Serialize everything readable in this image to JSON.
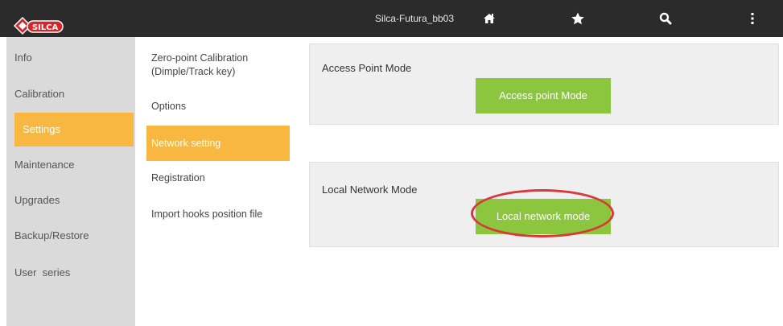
{
  "header": {
    "device_name": "Silca-Futura_bb03",
    "logo_text": "SILCA",
    "icons": [
      "home-icon",
      "star-icon",
      "search-icon",
      "more-vertical-icon"
    ]
  },
  "sidebar": {
    "items": [
      {
        "label": "Info"
      },
      {
        "label": "Calibration"
      },
      {
        "label": "Settings",
        "active": true
      },
      {
        "label": "Maintenance"
      },
      {
        "label": "Upgrades"
      },
      {
        "label": "Backup/Restore"
      },
      {
        "label": "User  series"
      }
    ]
  },
  "submenu": {
    "items": [
      {
        "label_line1": "Zero-point Calibration",
        "label_line2": "(Dimple/Track key)"
      },
      {
        "label": "Options"
      },
      {
        "label": "Network setting",
        "active": true
      },
      {
        "label": "Registration"
      },
      {
        "label": "Import hooks position file"
      }
    ]
  },
  "main": {
    "access_point": {
      "title": "Access Point Mode",
      "button_label": "Access point Mode"
    },
    "local_network": {
      "title": "Local Network Mode",
      "button_label": "Local network mode"
    }
  },
  "colors": {
    "topbar": "#2b2b2b",
    "accent_orange": "#f7b740",
    "button_green": "#8cc63f",
    "highlight_red": "#d9383a",
    "sidebar_bg": "#dadada",
    "panel_bg": "#efefef"
  }
}
